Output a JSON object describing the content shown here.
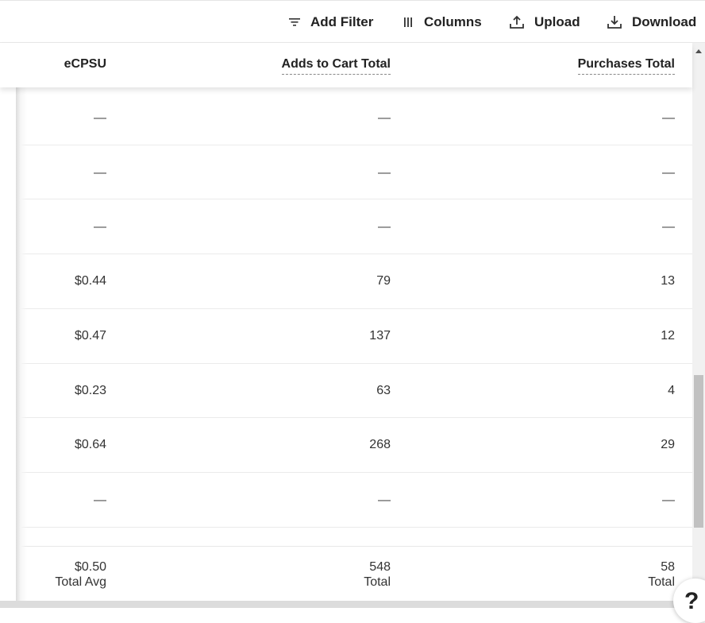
{
  "toolbar": {
    "add_filter": "Add Filter",
    "columns": "Columns",
    "upload": "Upload",
    "download": "Download"
  },
  "columns": {
    "ecpsu": "eCPSU",
    "adds_to_cart": "Adds to Cart Total",
    "purchases": "Purchases Total"
  },
  "rows": [
    {
      "ecpsu": "—",
      "adds": "—",
      "purchases": "—"
    },
    {
      "ecpsu": "—",
      "adds": "—",
      "purchases": "—"
    },
    {
      "ecpsu": "—",
      "adds": "—",
      "purchases": "—"
    },
    {
      "ecpsu": "$0.44",
      "adds": "79",
      "purchases": "13"
    },
    {
      "ecpsu": "$0.47",
      "adds": "137",
      "purchases": "12"
    },
    {
      "ecpsu": "$0.23",
      "adds": "63",
      "purchases": "4"
    },
    {
      "ecpsu": "$0.64",
      "adds": "268",
      "purchases": "29"
    },
    {
      "ecpsu": "—",
      "adds": "—",
      "purchases": "—"
    }
  ],
  "totals": {
    "ecpsu_value": "$0.50",
    "ecpsu_label": "Total Avg",
    "adds_value": "548",
    "adds_label": "Total",
    "purchases_value": "58",
    "purchases_label": "Total"
  },
  "help": {
    "glyph": "?"
  }
}
